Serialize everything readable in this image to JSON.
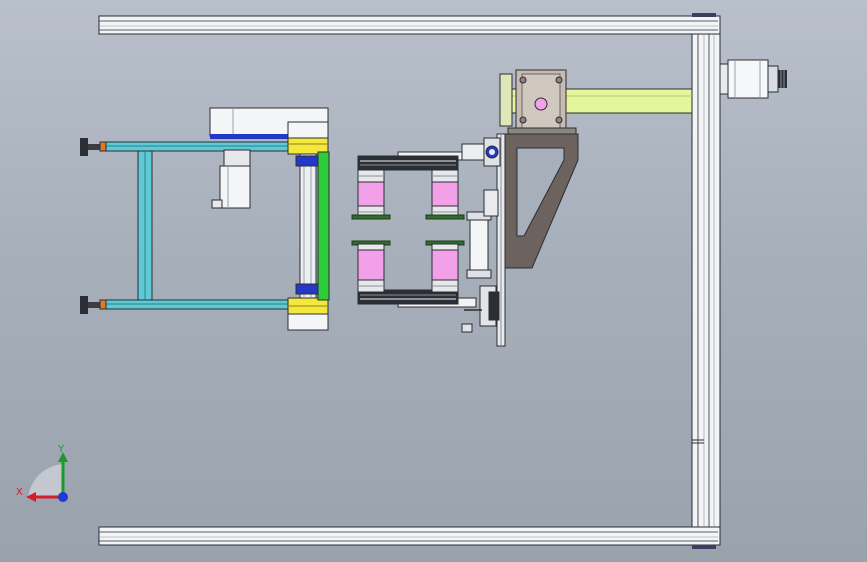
{
  "view": {
    "background_top": "#b9c0cb",
    "background_bottom": "#9aa2ae"
  },
  "colors": {
    "frame": "#f3f4f6",
    "frame_edge": "#2a2d33",
    "cyan_rail": "#5fc9d6",
    "yellow_block": "#f4e83c",
    "green_bar": "#2ecc3a",
    "lime_beam": "#e4f59a",
    "pink_roll": "#f2a0e8",
    "bracket_brown": "#6c635e",
    "motor_plate": "#c6bcb2",
    "blue_accent": "#2438c8"
  },
  "triad": {
    "x_label": "X",
    "y_label": "Y",
    "x_color": "#d0202a",
    "y_color": "#1a9a2a",
    "z_color": "#1f3ad0"
  }
}
